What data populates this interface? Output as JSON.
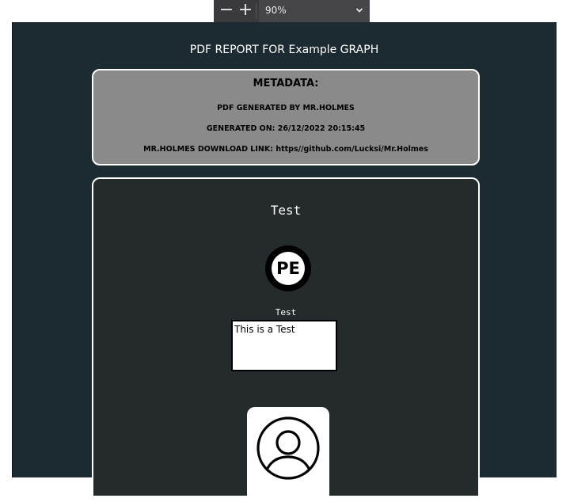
{
  "toolbar": {
    "zoom_out_label": "−",
    "zoom_in_label": "+",
    "zoom_value": "90%"
  },
  "report": {
    "title": "PDF REPORT FOR Example GRAPH"
  },
  "metadata": {
    "heading": "METADATA:",
    "generated_by": "PDF GENERATED BY MR.HOLMES",
    "generated_on": "GENERATED ON: 26/12/2022 20:15:45",
    "download_link": "MR.HOLMES DOWNLOAD LINK: https//github.com/Lucksi/Mr.Holmes"
  },
  "card": {
    "title": "Test",
    "logo_text": "PE",
    "field_label": "Test",
    "field_value": "This is a Test"
  },
  "colors": {
    "page_bg": "#1c2a32",
    "card_bg": "#252a2d",
    "meta_bg": "#8a8a8a",
    "toolbar_bg": "#3a3a3c"
  },
  "icons": {
    "zoom_dropdown": "chevron-down-icon",
    "avatar": "user-avatar-icon",
    "logo": "pe-logo-icon"
  }
}
